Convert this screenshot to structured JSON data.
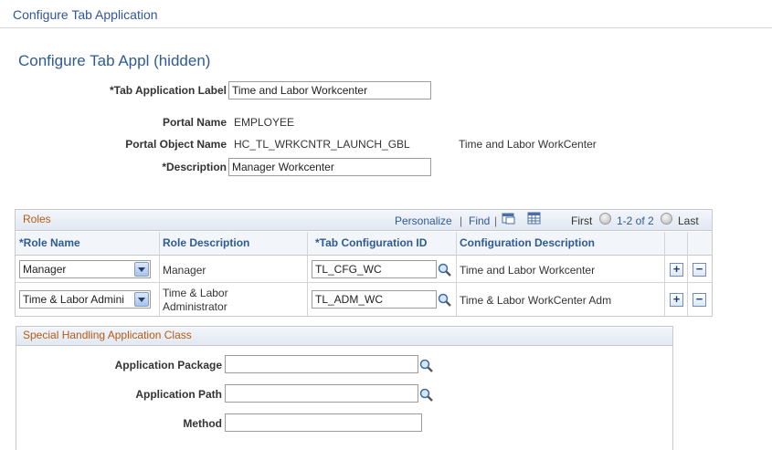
{
  "window": {
    "title": "Configure Tab Application"
  },
  "page": {
    "title": "Configure Tab Appl (hidden)"
  },
  "form": {
    "tab_app_label": {
      "label": "*Tab Application Label",
      "value": "Time and Labor Workcenter"
    },
    "portal_name": {
      "label": "Portal Name",
      "value": "EMPLOYEE"
    },
    "portal_object_name": {
      "label": "Portal Object Name",
      "value": "HC_TL_WRKCNTR_LAUNCH_GBL",
      "description": "Time and Labor WorkCenter"
    },
    "description": {
      "label": "*Description",
      "value": "Manager Workcenter"
    }
  },
  "roles_grid": {
    "caption": "Roles",
    "toolbar": {
      "personalize": "Personalize",
      "separator": "|",
      "find": "Find",
      "separator2": "|",
      "first": "First",
      "range": "1-2 of 2",
      "last": "Last"
    },
    "columns": [
      "*Role Name",
      "Role Description",
      "*Tab Configuration ID",
      "Configuration Description"
    ],
    "rows": [
      {
        "role_name": "Manager",
        "role_description": "Manager",
        "tab_config_id": "TL_CFG_WC",
        "config_description": "Time and Labor Workcenter"
      },
      {
        "role_name": "Time & Labor Admini",
        "role_description_line1": "Time & Labor",
        "role_description_line2": "Administrator",
        "tab_config_id": "TL_ADM_WC",
        "config_description": "Time & Labor WorkCenter Adm"
      }
    ],
    "add_symbol": "+",
    "remove_symbol": "−"
  },
  "special_handling": {
    "title": "Special Handling Application Class",
    "application_package": {
      "label": "Application Package",
      "value": ""
    },
    "application_path": {
      "label": "Application Path",
      "value": ""
    },
    "method": {
      "label": "Method",
      "value": ""
    }
  },
  "icons": {
    "lookup": "magnifier-icon",
    "dropdown": "chevron-down-icon",
    "new_window": "new-window-icon",
    "download": "spreadsheet-icon",
    "first": "prev-circle-icon",
    "last": "next-circle-icon"
  },
  "colors": {
    "link": "#2e5b93",
    "section_title": "#b65b15",
    "header_bg": "#e1e8f2"
  }
}
